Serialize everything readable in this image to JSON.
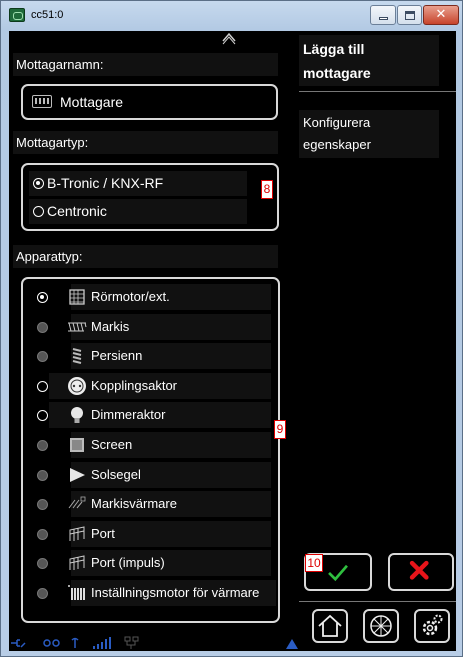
{
  "window": {
    "title": "cc51:0",
    "close_glyph": "✕"
  },
  "left": {
    "receiver_name_label": "Mottagarnamn:",
    "receiver_name_value": "Mottagare",
    "receiver_type_label": "Mottagartyp:",
    "receiver_types": [
      {
        "label": "B-Tronic / KNX-RF",
        "selected": true
      },
      {
        "label": "Centronic",
        "selected": false
      }
    ],
    "device_type_label": "Apparattyp:",
    "device_types": [
      {
        "label": "Rörmotor/ext.",
        "icon": "tubular-motor-icon",
        "state": "selected"
      },
      {
        "label": "Markis",
        "icon": "awning-icon",
        "state": "disabled"
      },
      {
        "label": "Persienn",
        "icon": "venetian-blind-icon",
        "state": "disabled"
      },
      {
        "label": "Kopplingsaktor",
        "icon": "socket-icon",
        "state": "enabled"
      },
      {
        "label": "Dimmeraktor",
        "icon": "bulb-icon",
        "state": "enabled"
      },
      {
        "label": "Screen",
        "icon": "screen-icon",
        "state": "disabled"
      },
      {
        "label": "Solsegel",
        "icon": "sun-sail-icon",
        "state": "disabled"
      },
      {
        "label": "Markisvärmare",
        "icon": "awning-heater-icon",
        "state": "disabled"
      },
      {
        "label": "Port",
        "icon": "gate-icon",
        "state": "disabled"
      },
      {
        "label": "Port (impuls)",
        "icon": "gate-impulse-icon",
        "state": "disabled"
      },
      {
        "label": "Inställningsmotor för värmare",
        "icon": "heater-motor-icon",
        "state": "disabled"
      }
    ]
  },
  "right": {
    "title": "Lägga till mottagare",
    "configure": "Konfigurera egenskaper"
  },
  "badges": {
    "receiver_type": "8",
    "device_type": "9",
    "confirm": "10"
  },
  "colors": {
    "confirm_check": "#2fbf3f",
    "cancel_x": "#e8141a",
    "status_icons": "#2a5cc4",
    "badge_red": "#dd0000"
  }
}
